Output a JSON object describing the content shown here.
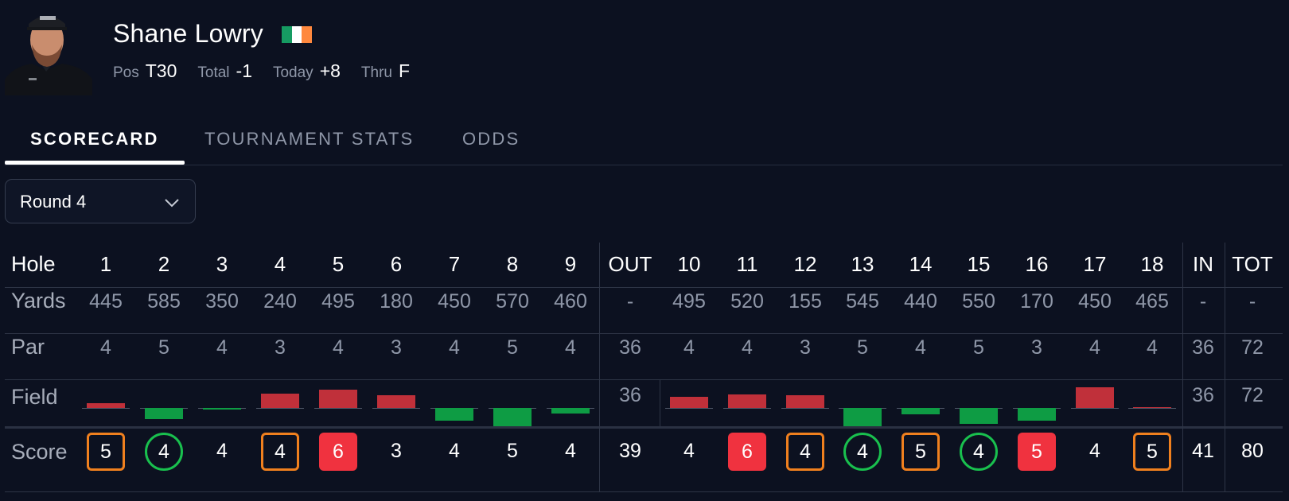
{
  "player": {
    "name": "Shane Lowry",
    "flag": {
      "country": "ireland-flag",
      "colors": [
        "#169b62",
        "#ffffff",
        "#ff883e"
      ]
    },
    "stats": [
      {
        "label": "Pos",
        "value": "T30"
      },
      {
        "label": "Total",
        "value": "-1"
      },
      {
        "label": "Today",
        "value": "+8"
      },
      {
        "label": "Thru",
        "value": "F"
      }
    ]
  },
  "tabs": [
    {
      "label": "SCORECARD",
      "active": true
    },
    {
      "label": "TOURNAMENT STATS",
      "active": false
    },
    {
      "label": "ODDS",
      "active": false
    }
  ],
  "round_select": {
    "value": "Round 4",
    "icon": "chevron-down-icon"
  },
  "colors": {
    "background": "#0c1120",
    "bogey": "#f0801e",
    "birdie": "#19c04e",
    "double_bogey": "#f0323f",
    "field_over": "#c0303a",
    "field_under": "#0e9c44"
  },
  "scorecard": {
    "row_labels": {
      "hole": "Hole",
      "yards": "Yards",
      "par": "Par",
      "field": "Field",
      "score": "Score"
    },
    "columns": [
      "1",
      "2",
      "3",
      "4",
      "5",
      "6",
      "7",
      "8",
      "9",
      "OUT",
      "10",
      "11",
      "12",
      "13",
      "14",
      "15",
      "16",
      "17",
      "18",
      "IN",
      "TOT"
    ],
    "yards": [
      "445",
      "585",
      "350",
      "240",
      "495",
      "180",
      "450",
      "570",
      "460",
      "-",
      "495",
      "520",
      "155",
      "545",
      "440",
      "550",
      "170",
      "450",
      "465",
      "-",
      "-"
    ],
    "par": [
      "4",
      "5",
      "4",
      "3",
      "4",
      "3",
      "4",
      "5",
      "4",
      "36",
      "4",
      "4",
      "3",
      "5",
      "4",
      "5",
      "3",
      "4",
      "4",
      "36",
      "72"
    ],
    "field_avg_vs_par": [
      0.05,
      -0.12,
      -0.02,
      0.15,
      0.19,
      0.13,
      -0.13,
      -0.19,
      -0.06,
      null,
      0.12,
      0.14,
      0.13,
      -0.19,
      -0.07,
      -0.17,
      -0.13,
      0.22,
      0.01,
      null,
      null
    ],
    "field_totals": {
      "out": "36",
      "in": "36",
      "tot": "72"
    },
    "score": [
      "5",
      "4",
      "4",
      "4",
      "6",
      "3",
      "4",
      "5",
      "4",
      "39",
      "4",
      "6",
      "4",
      "4",
      "5",
      "4",
      "5",
      "4",
      "5",
      "41",
      "80"
    ],
    "score_type": [
      "bogey",
      "birdie",
      "par",
      "bogey",
      "double",
      "par",
      "par",
      "par",
      "par",
      "total",
      "par",
      "double",
      "bogey",
      "birdie",
      "bogey",
      "birdie",
      "double",
      "par",
      "bogey",
      "total",
      "total"
    ]
  }
}
